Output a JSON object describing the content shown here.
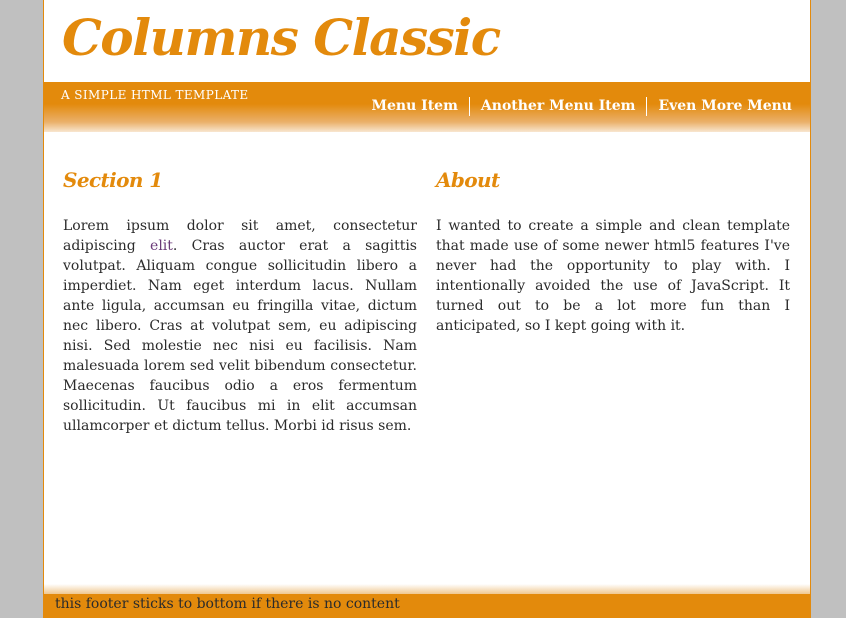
{
  "header": {
    "site_title": "Columns Classic",
    "tagline": "A SIMPLE HTML TEMPLATE"
  },
  "nav": {
    "items": [
      {
        "label": "Menu Item"
      },
      {
        "label": "Another Menu Item"
      },
      {
        "label": "Even More Menu"
      }
    ]
  },
  "main": {
    "section1": {
      "heading": "Section 1",
      "text_before_link": "Lorem ipsum dolor sit amet, consectetur adipiscing ",
      "link_text": "elit",
      "text_after_link": ". Cras auctor erat a sagittis volutpat. Aliquam congue sollicitudin libero a imperdiet. Nam eget interdum lacus. Nullam ante ligula, accumsan eu fringilla vitae, dictum nec libero. Cras at volutpat sem, eu adipiscing nisi. Sed molestie nec nisi eu facilisis. Nam malesuada lorem sed velit bibendum consectetur. Maecenas faucibus odio a eros fermentum sollicitudin. Ut faucibus mi in elit accumsan ullamcorper et dictum tellus. Morbi id risus sem."
    },
    "about": {
      "heading": "About",
      "text": "I wanted to create a simple and clean template that made use of some newer html5 features I've never had the opportunity to play with. I intentionally avoided the use of JavaScript. It turned out to be a lot more fun than I anticipated, so I kept going with it."
    }
  },
  "footer": {
    "text": "this footer sticks to bottom if there is no content"
  },
  "colors": {
    "accent": "#e38a0c",
    "page_background": "#c0c0c0",
    "content_background": "#ffffff",
    "link": "#6a3a78"
  }
}
